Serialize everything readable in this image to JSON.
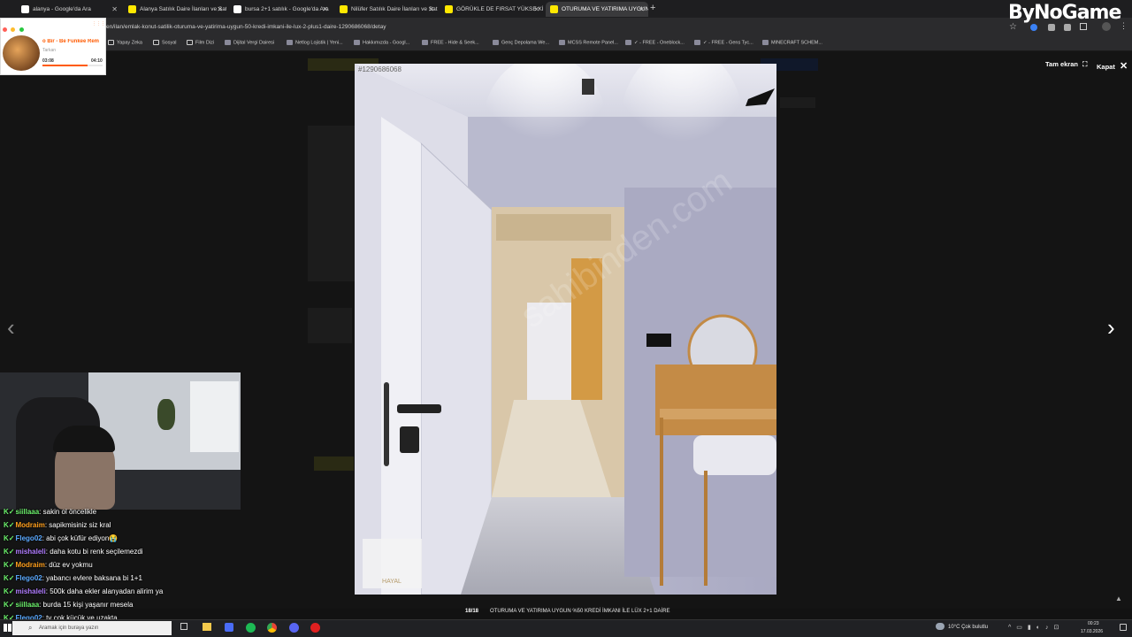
{
  "browser": {
    "tabs": [
      {
        "label": "alanya - Google'da Ara",
        "icon": "google-icon",
        "color": "#ffffff"
      },
      {
        "label": "Alanya Satılık Daire İlanları ve Satılık Ev Fiyatları",
        "icon": "sahibinden-icon",
        "color": "#ffe800"
      },
      {
        "label": "bursa 2+1 satılık - Google'da Ara",
        "icon": "google-icon",
        "color": "#ffffff"
      },
      {
        "label": "Nilüfer Satılık Daire İlanları ve Satılık Ev",
        "icon": "sahibinden-icon",
        "color": "#ffe800"
      },
      {
        "label": "GÖRÜKLE DE FIRSAT YÜKSE KİR",
        "icon": "sahibinden-icon",
        "color": "#ffe800"
      },
      {
        "label": "OTURUMA VE YATIRIMA UYGUN",
        "icon": "sahibinden-icon",
        "color": "#ffe800",
        "active": true
      }
    ],
    "new_tab": "+",
    "url": "en/ilan/emlak-konut-satilik-oturuma-ve-yatirima-uygun-50-kredi-imkani-ile-lux-2-plus1-daire-1290686068/detay",
    "bookmarks": [
      {
        "label": "Yapay Zeka",
        "icon": "folder-icon"
      },
      {
        "label": "Sosyal",
        "icon": "folder-icon"
      },
      {
        "label": "Film Dizi",
        "icon": "folder-icon"
      },
      {
        "label": "Dijital Vergi Dairesi",
        "icon": "page-icon"
      },
      {
        "label": "Netlog Lojistik | Yeni...",
        "icon": "page-icon"
      },
      {
        "label": "Hakkımızda - Googl...",
        "icon": "page-icon"
      },
      {
        "label": "FREE - Hide & Seek...",
        "icon": "page-icon"
      },
      {
        "label": "Genç Depolama We...",
        "icon": "page-icon"
      },
      {
        "label": "MCSS Remote Panel...",
        "icon": "page-icon"
      },
      {
        "label": "✓ - FREE - Oneblock...",
        "icon": "page-icon"
      },
      {
        "label": "✓ - FREE - Gens Tyc...",
        "icon": "page-icon"
      },
      {
        "label": "MINECRAFT SCHEM...",
        "icon": "page-icon"
      }
    ]
  },
  "overlay": {
    "brand": "ByNoGame"
  },
  "music_widget": {
    "title": "o Bir - Be Funkee Rem",
    "artist": "Tarkan",
    "current_time": "03:08",
    "total_time": "04:10",
    "progress": 0.75,
    "accent": "#ff5a00"
  },
  "lightbox": {
    "fullscreen_label": "Tam ekran",
    "close_label": "Kapat",
    "counter": "18/18",
    "caption": "OTURUMA VE YATIRIMA UYGUN %50 KREDİ İMKANI İLE LÜX 2+1 DAİRE",
    "listing_id": "#1290686068",
    "watermark_brand": "HAYAL"
  },
  "chat": [
    {
      "user": "siillaaa",
      "message": "sakin ol öncelikle",
      "color": "#6cf26c"
    },
    {
      "user": "Modraim",
      "message": "sapikmisiniz siz kral",
      "color": "#ff9f1c"
    },
    {
      "user": "Flego02",
      "message": "abi çok küfür ediyon😭",
      "color": "#5aa9ff"
    },
    {
      "user": "mishaleli",
      "message": "daha kotu bi renk seçilemezdi",
      "color": "#b07cff"
    },
    {
      "user": "Modraim",
      "message": "düz ev yokmu",
      "color": "#ff9f1c"
    },
    {
      "user": "Flego02",
      "message": "yabancı evlere baksana bi 1+1",
      "color": "#5aa9ff"
    },
    {
      "user": "mishaleli",
      "message": "500k daha ekler alanyadan alirim ya",
      "color": "#b07cff"
    },
    {
      "user": "siillaaa",
      "message": "burda 15 kişi yaşanır mesela",
      "color": "#6cf26c"
    },
    {
      "user": "Flego02",
      "message": "tv çok küçük ve uzakta",
      "color": "#5aa9ff"
    }
  ],
  "taskbar": {
    "search_placeholder": "Aramak için buraya yazın",
    "weather": "10°C  Çok bulutlu",
    "time": "00:23",
    "date": "17.03.2026"
  }
}
